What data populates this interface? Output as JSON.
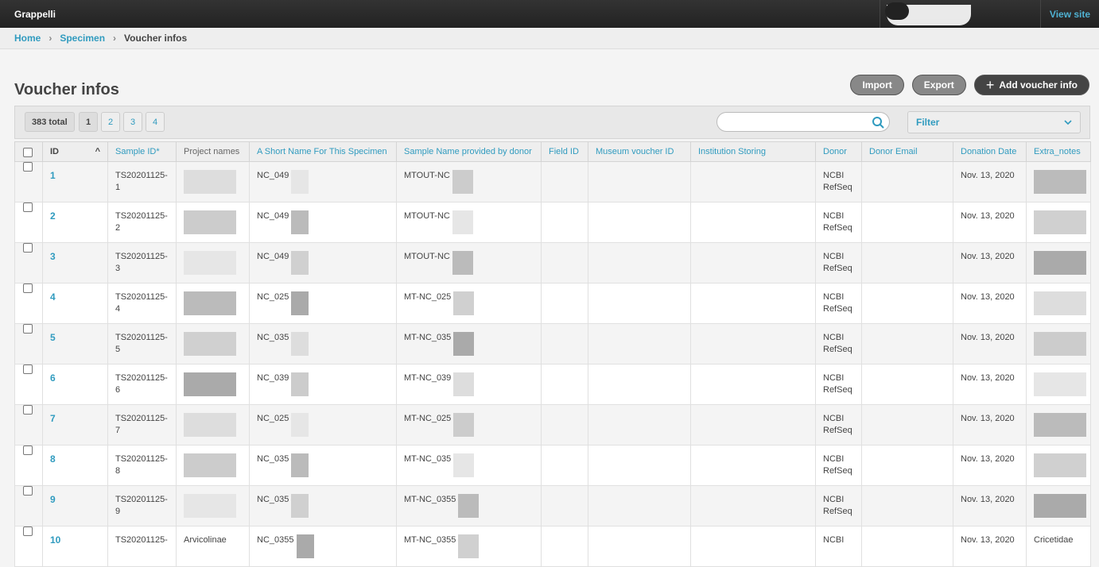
{
  "app": {
    "brand": "Grappelli",
    "view_site": "View site"
  },
  "breadcrumb": [
    "Home",
    "Specimen",
    "Voucher infos"
  ],
  "page": {
    "title": "Voucher infos"
  },
  "tools": {
    "import": "Import",
    "export": "Export",
    "add": "Add voucher info"
  },
  "pagination": {
    "total": "383 total",
    "pages": [
      "1",
      "2",
      "3",
      "4"
    ],
    "current": "1"
  },
  "filter": {
    "label": "Filter"
  },
  "search": {
    "placeholder": ""
  },
  "table": {
    "columns": [
      "ID",
      "Sample ID*",
      "Project names",
      "A Short Name For This Specimen",
      "Sample Name provided by donor",
      "Field ID",
      "Museum voucher ID",
      "Institution Storing",
      "Donor",
      "Donor Email",
      "Donation Date",
      "Extra_notes"
    ],
    "rows": [
      {
        "id": "1",
        "sample_id": "TS20201125-1",
        "short_name": "NC_049",
        "donor_name": "MTOUT-NC",
        "donor": "NCBI RefSeq",
        "date": "Nov. 13, 2020"
      },
      {
        "id": "2",
        "sample_id": "TS20201125-2",
        "short_name": "NC_049",
        "donor_name": "MTOUT-NC",
        "donor": "NCBI RefSeq",
        "date": "Nov. 13, 2020"
      },
      {
        "id": "3",
        "sample_id": "TS20201125-3",
        "short_name": "NC_049",
        "donor_name": "MTOUT-NC",
        "donor": "NCBI RefSeq",
        "date": "Nov. 13, 2020"
      },
      {
        "id": "4",
        "sample_id": "TS20201125-4",
        "short_name": "NC_025",
        "donor_name": "MT-NC_025",
        "donor": "NCBI RefSeq",
        "date": "Nov. 13, 2020"
      },
      {
        "id": "5",
        "sample_id": "TS20201125-5",
        "short_name": "NC_035",
        "donor_name": "MT-NC_035",
        "donor": "NCBI RefSeq",
        "date": "Nov. 13, 2020"
      },
      {
        "id": "6",
        "sample_id": "TS20201125-6",
        "short_name": "NC_039",
        "donor_name": "MT-NC_039",
        "donor": "NCBI RefSeq",
        "date": "Nov. 13, 2020"
      },
      {
        "id": "7",
        "sample_id": "TS20201125-7",
        "short_name": "NC_025",
        "donor_name": "MT-NC_025",
        "donor": "NCBI RefSeq",
        "date": "Nov. 13, 2020"
      },
      {
        "id": "8",
        "sample_id": "TS20201125-8",
        "short_name": "NC_035",
        "donor_name": "MT-NC_035",
        "donor": "NCBI RefSeq",
        "date": "Nov. 13, 2020"
      },
      {
        "id": "9",
        "sample_id": "TS20201125-9",
        "short_name": "NC_035",
        "donor_name": "MT-NC_0355",
        "donor": "NCBI RefSeq",
        "date": "Nov. 13, 2020"
      },
      {
        "id": "10",
        "sample_id": "TS20201125-",
        "short_name": "NC_0355",
        "donor_name": "MT-NC_0355",
        "donor": "NCBI",
        "date": "Nov. 13, 2020",
        "project": "Arvicolinae",
        "extra": "Cricetidae"
      }
    ]
  }
}
